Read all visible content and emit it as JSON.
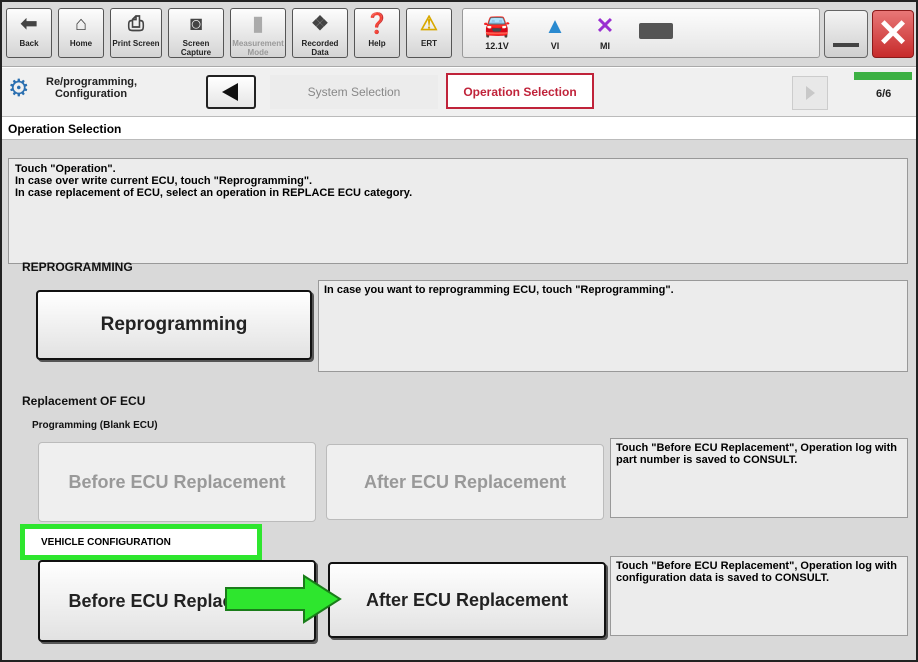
{
  "toolbar": {
    "back_label": "Back",
    "home_label": "Home",
    "print_label": "Print Screen",
    "capture_label": "Screen Capture",
    "measurement_label": "Measurement Mode",
    "recorded_label": "Recorded Data",
    "help_label": "Help",
    "ert_label": "ERT",
    "voltage_label": "12.1V",
    "vi_label": "VI",
    "mi_label": "MI"
  },
  "breadcrumb": {
    "module_label": "Re/programming, Configuration",
    "system_selection": "System Selection",
    "operation_selection": "Operation Selection",
    "step": "6/6",
    "progress_fraction": 1.0
  },
  "page": {
    "title": "Operation Selection",
    "instructions": [
      "Touch \"Operation\".",
      "In case over write current ECU, touch \"Reprogramming\".",
      "In case replacement of ECU, select an operation in REPLACE ECU category."
    ]
  },
  "reprogramming": {
    "section_label": "REPROGRAMMING",
    "button_label": "Reprogramming",
    "description": "In case you want to reprogramming ECU, touch \"Reprogramming\"."
  },
  "replacement": {
    "section_label": "Replacement OF ECU",
    "blank_subsection": "Programming (Blank ECU)",
    "blank_before_label": "Before ECU Replacement",
    "blank_after_label": "After ECU Replacement",
    "blank_description": "Touch \"Before ECU Replacement\", Operation log with part number is saved to CONSULT.",
    "config_subsection": "VEHICLE CONFIGURATION",
    "config_before_label": "Before ECU Replacement",
    "config_after_label": "After ECU Replacement",
    "config_description": "Touch \"Before ECU Replacement\", Operation log with configuration data is saved to CONSULT."
  },
  "colors": {
    "highlight": "#2ee62e",
    "active_crumb": "#c0233a",
    "close": "#c72b2b"
  }
}
